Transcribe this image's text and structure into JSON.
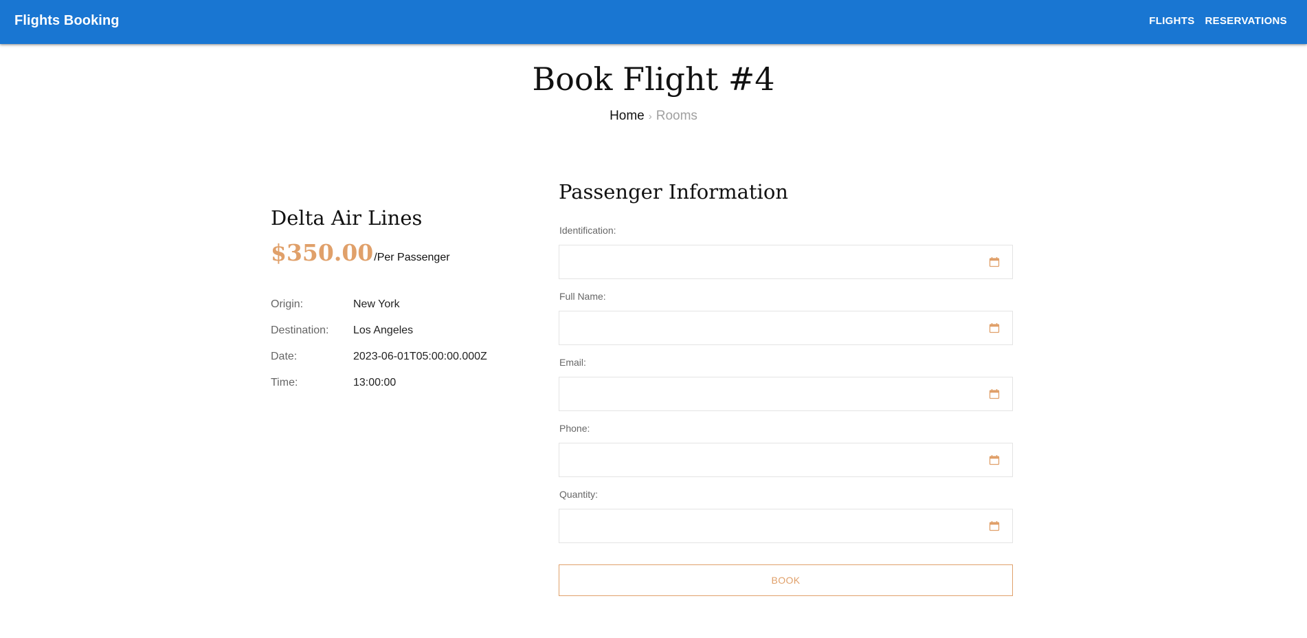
{
  "navbar": {
    "brand": "Flights Booking",
    "links": [
      "FLIGHTS",
      "RESERVATIONS"
    ],
    "color": "#1976d2"
  },
  "page": {
    "title": "Book Flight #4",
    "breadcrumb": {
      "home": "Home",
      "separator": "›",
      "current": "Rooms"
    }
  },
  "flight": {
    "airline": "Delta Air Lines",
    "price": "$350.00",
    "price_unit": "/Per Passenger",
    "details": [
      {
        "label": "Origin:",
        "value": "New York"
      },
      {
        "label": "Destination:",
        "value": "Los Angeles"
      },
      {
        "label": "Date:",
        "value": "2023-06-01T05:00:00.000Z"
      },
      {
        "label": "Time:",
        "value": "13:00:00"
      }
    ]
  },
  "form": {
    "title": "Passenger Information",
    "fields": [
      {
        "label": "Identification:",
        "value": "",
        "icon": "calendar-icon"
      },
      {
        "label": "Full Name:",
        "value": "",
        "icon": "calendar-icon"
      },
      {
        "label": "Email:",
        "value": "",
        "icon": "calendar-icon"
      },
      {
        "label": "Phone:",
        "value": "",
        "icon": "calendar-icon"
      },
      {
        "label": "Quantity:",
        "value": "",
        "icon": "calendar-icon"
      }
    ],
    "submit_label": "BOOK",
    "accent_color": "#e0a06a"
  }
}
